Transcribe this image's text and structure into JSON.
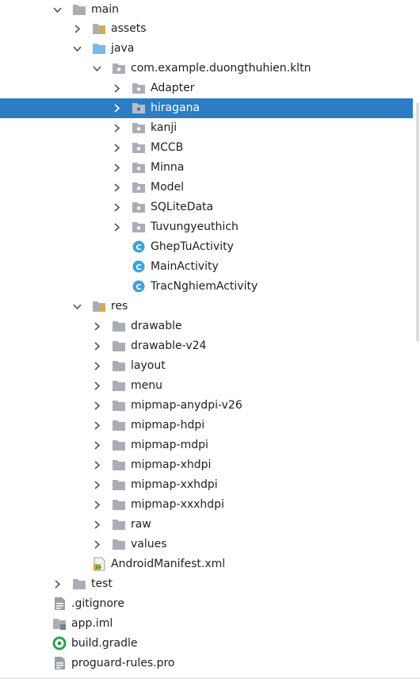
{
  "tree": {
    "main": {
      "label": "main",
      "icon": "folder-icon",
      "expanded": true
    },
    "assets": {
      "label": "assets",
      "icon": "resource-folder-icon",
      "expanded": false
    },
    "java": {
      "label": "java",
      "icon": "source-folder-icon",
      "expanded": true
    },
    "package": {
      "label": "com.example.duongthuhien.kltn",
      "icon": "package-icon",
      "expanded": true
    },
    "adapter": {
      "label": "Adapter",
      "icon": "package-icon",
      "expanded": false
    },
    "hiragana": {
      "label": "hiragana",
      "icon": "package-icon",
      "expanded": false,
      "selected": true
    },
    "kanji": {
      "label": "kanji",
      "icon": "package-icon",
      "expanded": false
    },
    "mccb": {
      "label": "MCCB",
      "icon": "package-icon",
      "expanded": false
    },
    "minna": {
      "label": "Minna",
      "icon": "package-icon",
      "expanded": false
    },
    "model": {
      "label": "Model",
      "icon": "package-icon",
      "expanded": false
    },
    "sqlitedata": {
      "label": "SQLiteData",
      "icon": "package-icon",
      "expanded": false
    },
    "tuvungyeuthich": {
      "label": "Tuvungyeuthich",
      "icon": "package-icon",
      "expanded": false
    },
    "ghep": {
      "label": "GhepTuActivity",
      "icon": "class-icon",
      "class_letter": "C"
    },
    "mainactivity": {
      "label": "MainActivity",
      "icon": "class-icon",
      "class_letter": "C"
    },
    "tracnghiem": {
      "label": "TracNghiemActivity",
      "icon": "class-icon",
      "class_letter": "C"
    },
    "res": {
      "label": "res",
      "icon": "resource-folder-icon",
      "expanded": true
    },
    "drawable": {
      "label": "drawable",
      "icon": "folder-icon",
      "expanded": false
    },
    "drawable_v24": {
      "label": "drawable-v24",
      "icon": "folder-icon",
      "expanded": false
    },
    "layout": {
      "label": "layout",
      "icon": "folder-icon",
      "expanded": false
    },
    "menu": {
      "label": "menu",
      "icon": "folder-icon",
      "expanded": false
    },
    "mipmap_anydpi": {
      "label": "mipmap-anydpi-v26",
      "icon": "folder-icon",
      "expanded": false
    },
    "mipmap_hdpi": {
      "label": "mipmap-hdpi",
      "icon": "folder-icon",
      "expanded": false
    },
    "mipmap_mdpi": {
      "label": "mipmap-mdpi",
      "icon": "folder-icon",
      "expanded": false
    },
    "mipmap_xhdpi": {
      "label": "mipmap-xhdpi",
      "icon": "folder-icon",
      "expanded": false
    },
    "mipmap_xxhdpi": {
      "label": "mipmap-xxhdpi",
      "icon": "folder-icon",
      "expanded": false
    },
    "mipmap_xxxhdpi": {
      "label": "mipmap-xxxhdpi",
      "icon": "folder-icon",
      "expanded": false
    },
    "raw": {
      "label": "raw",
      "icon": "folder-icon",
      "expanded": false
    },
    "values": {
      "label": "values",
      "icon": "folder-icon",
      "expanded": false
    },
    "manifest": {
      "label": "AndroidManifest.xml",
      "icon": "manifest-icon"
    },
    "test": {
      "label": "test",
      "icon": "folder-icon",
      "expanded": false
    },
    "gitignore": {
      "label": ".gitignore",
      "icon": "file-icon"
    },
    "app_iml": {
      "label": "app.iml",
      "icon": "module-file-icon"
    },
    "build_gradle": {
      "label": "build.gradle",
      "icon": "gradle-icon"
    },
    "proguard": {
      "label": "proguard-rules.pro",
      "icon": "file-icon"
    }
  },
  "colors": {
    "selection": "#2d7dc5",
    "folder": "#a9aeb6",
    "source_folder": "#7fb6e3",
    "class_icon": "#3ea3d8",
    "resource_bars": "#e5a53d",
    "text": "#1f1f1f"
  }
}
